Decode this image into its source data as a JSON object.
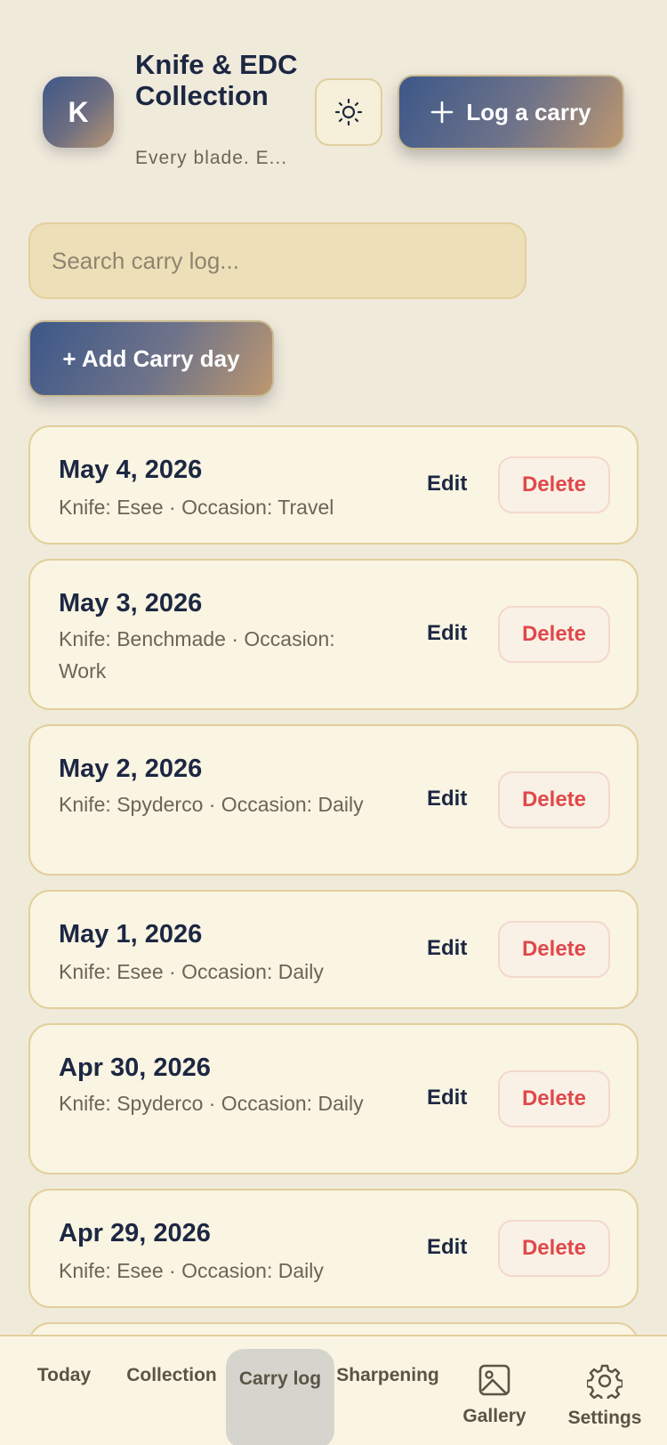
{
  "header": {
    "avatar_letter": "K",
    "title": "Knife & EDC Collection",
    "subtitle": "Every blade. E...",
    "theme_icon": "sun-icon",
    "log_button_label": "Log a carry"
  },
  "search": {
    "placeholder": "Search carry log..."
  },
  "add_button_label": "+ Add Carry day",
  "entries": [
    {
      "date": "May 4, 2026",
      "meta": "Knife: Esee · Occasion: Travel",
      "edit": "Edit",
      "delete": "Delete"
    },
    {
      "date": "May 3, 2026",
      "meta": "Knife: Benchmade · Occasion: Work",
      "edit": "Edit",
      "delete": "Delete"
    },
    {
      "date": "May 2, 2026",
      "meta": "Knife: Spyderco · Occasion: Daily",
      "edit": "Edit",
      "delete": "Delete"
    },
    {
      "date": "May 1, 2026",
      "meta": "Knife: Esee · Occasion: Daily",
      "edit": "Edit",
      "delete": "Delete"
    },
    {
      "date": "Apr 30, 2026",
      "meta": "Knife: Spyderco · Occasion: Daily",
      "edit": "Edit",
      "delete": "Delete"
    },
    {
      "date": "Apr 29, 2026",
      "meta": "Knife: Esee · Occasion: Daily",
      "edit": "Edit",
      "delete": "Delete"
    }
  ],
  "nav": {
    "items": [
      {
        "label": "Today"
      },
      {
        "label": "Collection"
      },
      {
        "label": "Carry log",
        "active": true
      },
      {
        "label": "Sharpening"
      },
      {
        "label": "Gallery",
        "icon": "image-icon"
      },
      {
        "label": "Settings",
        "icon": "gear-icon"
      }
    ]
  },
  "colors": {
    "background": "#f0eadb",
    "card": "#faf4e3",
    "card_border": "#e2d09b",
    "text_primary": "#1c2742",
    "text_secondary": "#6c6456",
    "delete_red": "#e0484a",
    "gradient_start": "#3c5789",
    "gradient_end": "#bd9770"
  }
}
